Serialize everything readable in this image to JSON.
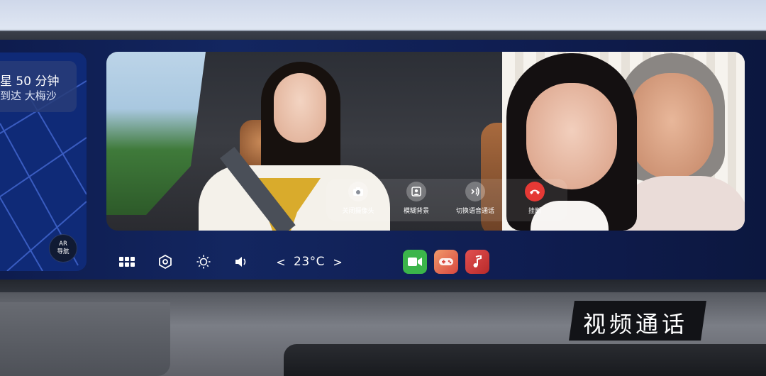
{
  "navigation": {
    "eta": "星 50 分钟",
    "destination": "到达 大梅沙",
    "ar_button": {
      "line1": "AR",
      "line2": "导航"
    }
  },
  "video_call": {
    "controls": [
      {
        "icon": "camera-icon",
        "label": "关闭摄像头"
      },
      {
        "icon": "blur-background-icon",
        "label": "模糊背景"
      },
      {
        "icon": "voice-switch-icon",
        "label": "切换语音通话"
      },
      {
        "icon": "hang-up-icon",
        "label": "挂断",
        "color": "#e53935"
      }
    ]
  },
  "bottom_bar": {
    "icons": [
      "apps-grid-icon",
      "settings-hexagon-icon",
      "brightness-icon",
      "volume-icon"
    ],
    "temperature": "23°C",
    "temp_decrease": "<",
    "temp_increase": ">",
    "apps": [
      {
        "icon": "video-call-app-icon",
        "color": "#3bb54a"
      },
      {
        "icon": "game-app-icon",
        "color": "#e2574c"
      },
      {
        "icon": "music-app-icon",
        "color": "#d83a3a"
      }
    ]
  },
  "caption": "视频通话"
}
